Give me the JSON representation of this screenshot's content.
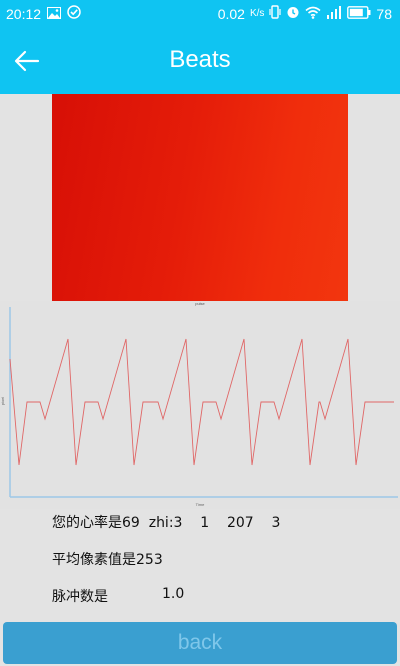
{
  "status_bar": {
    "time": "20:12",
    "speed": "0.02",
    "speed_unit": "K/s",
    "battery": "78",
    "icons": [
      "image-icon",
      "check-circle-icon",
      "vibrate-icon",
      "alarm-icon",
      "wifi-icon",
      "signal-icon",
      "battery-icon"
    ]
  },
  "app_bar": {
    "title": "Beats",
    "back_icon": "arrow-left-icon"
  },
  "chart_data": {
    "type": "line",
    "title": "pulse",
    "xlabel": "Time",
    "ylabel": "pixel",
    "series": [
      {
        "color": "#e06767",
        "values": [
          0.75,
          0.25,
          0.5,
          0.5,
          0.5,
          0.5,
          0.42,
          0.67,
          0.5,
          0.5
        ]
      }
    ],
    "pattern_note": "",
    "grid": false
  },
  "info": {
    "heart_rate_line": "您的心率是69  zhi:3    1    207    3",
    "avg_pixel_line": "平均像素值是253",
    "pulse_label": "脉冲数是",
    "pulse_value": "1.0"
  },
  "buttons": {
    "back_label": "back"
  },
  "colors": {
    "accent": "#0fc4f2",
    "button": "#3a9fd0",
    "button_text": "#7fc7ea",
    "line": "#e06767"
  }
}
